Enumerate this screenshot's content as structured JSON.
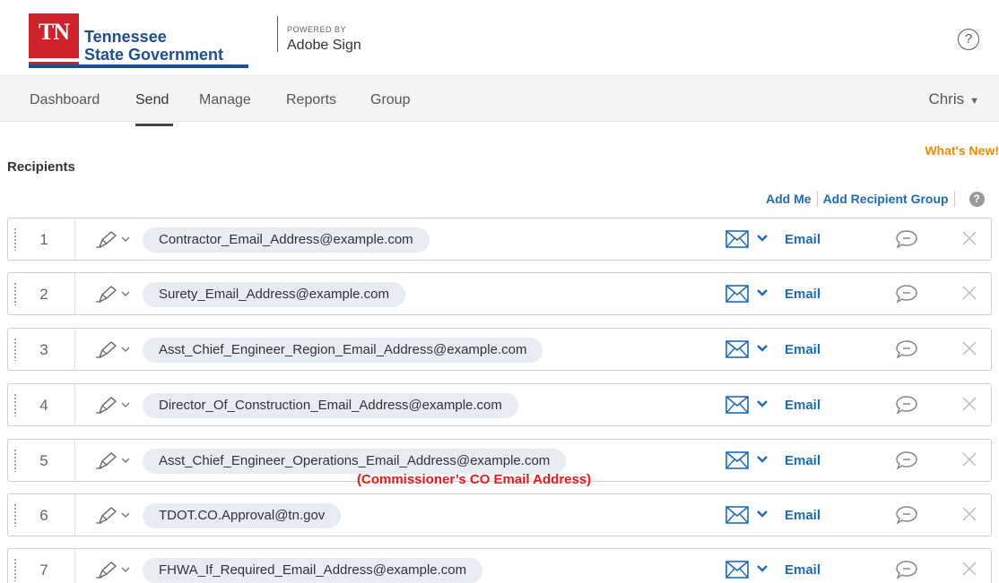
{
  "header": {
    "logo_letters": "TN",
    "org_line1": "Tennessee",
    "org_line2": "State Government",
    "powered_by": "POWERED BY",
    "product": "Adobe Sign",
    "help_symbol": "?"
  },
  "nav": {
    "items": [
      "Dashboard",
      "Send",
      "Manage",
      "Reports",
      "Group"
    ],
    "active": "Send",
    "user": "Chris"
  },
  "whats_new": "What's New!",
  "recipients": {
    "title": "Recipients",
    "add_me": "Add Me",
    "add_group": "Add Recipient Group",
    "help_symbol": "?",
    "rows": [
      {
        "number": "1",
        "email": "Contractor_Email_Address@example.com",
        "delivery": "Email"
      },
      {
        "number": "2",
        "email": "Surety_Email_Address@example.com",
        "delivery": "Email"
      },
      {
        "number": "3",
        "email": "Asst_Chief_Engineer_Region_Email_Address@example.com",
        "delivery": "Email"
      },
      {
        "number": "4",
        "email": "Director_Of_Construction_Email_Address@example.com",
        "delivery": "Email"
      },
      {
        "number": "5",
        "email": "Asst_Chief_Engineer_Operations_Email_Address@example.com",
        "delivery": "Email"
      },
      {
        "number": "6",
        "email": "TDOT.CO.Approval@tn.gov",
        "delivery": "Email"
      },
      {
        "number": "7",
        "email": "FHWA_If_Required_Email_Address@example.com",
        "delivery": "Email"
      }
    ]
  },
  "annotation": "(Commissioner’s CO Email Address)",
  "colors": {
    "tn_red": "#cc2229",
    "tn_blue": "#1f4d8f",
    "link_blue": "#1f6bb5",
    "whats_new_orange": "#f08a00",
    "annotation_red": "#e41b1b",
    "pill_bg": "#e7ecf4"
  },
  "icons": {
    "role": "pen-signer-icon",
    "delivery": "envelope-icon",
    "dropdown": "chevron-down-icon",
    "comment": "speech-bubble-icon",
    "remove": "close-icon",
    "drag": "drag-handle-icon"
  }
}
